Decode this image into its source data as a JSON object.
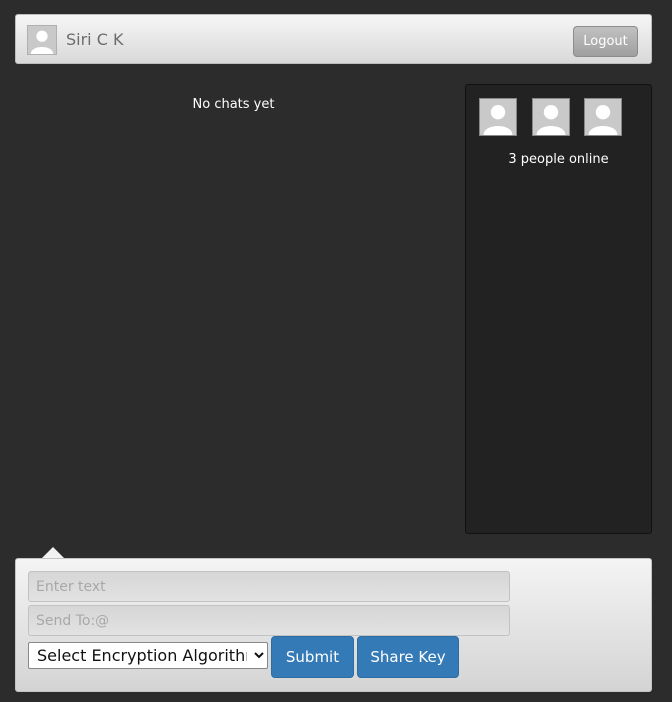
{
  "header": {
    "user_name": "Siri C K",
    "logout_label": "Logout"
  },
  "chat": {
    "empty_message": "No chats yet"
  },
  "online": {
    "avatars": [
      "user-avatar-icon",
      "user-avatar-icon",
      "user-avatar-icon"
    ],
    "count_label": "3 people online"
  },
  "compose": {
    "message_placeholder": "Enter text",
    "recipient_placeholder": "Send To:@",
    "algorithm_selected": "Select Encryption Algorithm",
    "submit_label": "Submit",
    "share_key_label": "Share Key"
  },
  "colors": {
    "background": "#2c2c2c",
    "panel": "#222222",
    "primary_button": "#337ab7",
    "logout_button": "#b0b0b0"
  }
}
